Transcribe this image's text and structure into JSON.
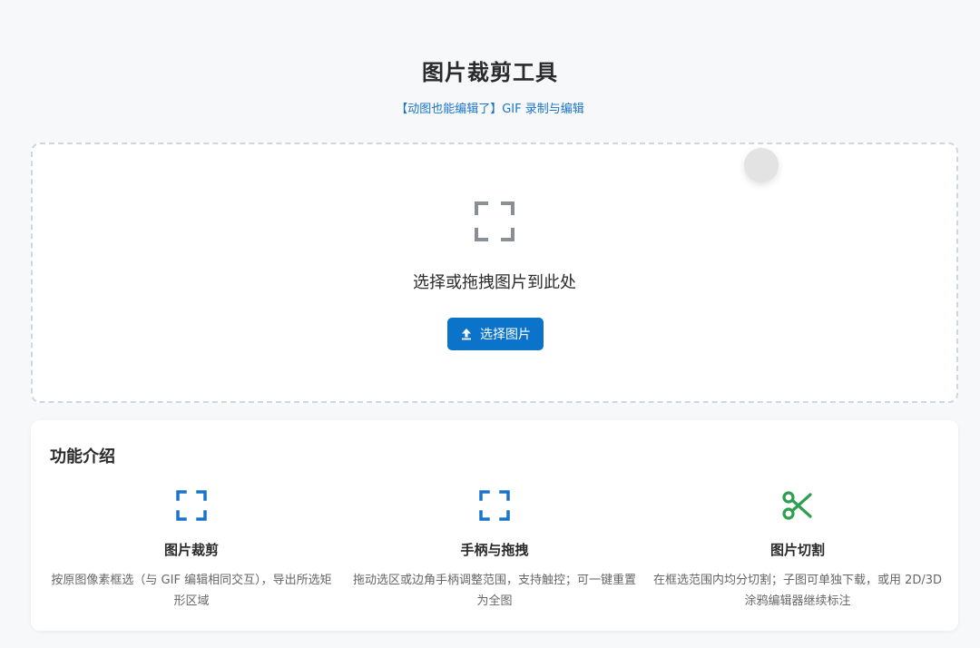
{
  "header": {
    "title": "图片裁剪工具",
    "subtitle_link": "【动图也能编辑了】GIF 录制与编辑"
  },
  "dropzone": {
    "prompt": "选择或拖拽图片到此处",
    "icon": "crop-frame-icon",
    "button_label": "选择图片",
    "button_icon": "upload-icon",
    "accent_color": "#0b73c9"
  },
  "features": {
    "title": "功能介绍",
    "items": [
      {
        "icon": "crop-frame-icon",
        "icon_color": "#1a73c8",
        "name": "图片裁剪",
        "desc": "按原图像素框选（与 GIF 编辑相同交互），导出所选矩形区域"
      },
      {
        "icon": "crop-frame-icon",
        "icon_color": "#1a73c8",
        "name": "手柄与拖拽",
        "desc": "拖动选区或边角手柄调整范围，支持触控；可一键重置为全图"
      },
      {
        "icon": "scissors-icon",
        "icon_color": "#2e9e4f",
        "name": "图片切割",
        "desc": "在框选范围内均分切割；子图可单独下载，或用 2D/3D 涂鸦编辑器继续标注"
      }
    ]
  }
}
